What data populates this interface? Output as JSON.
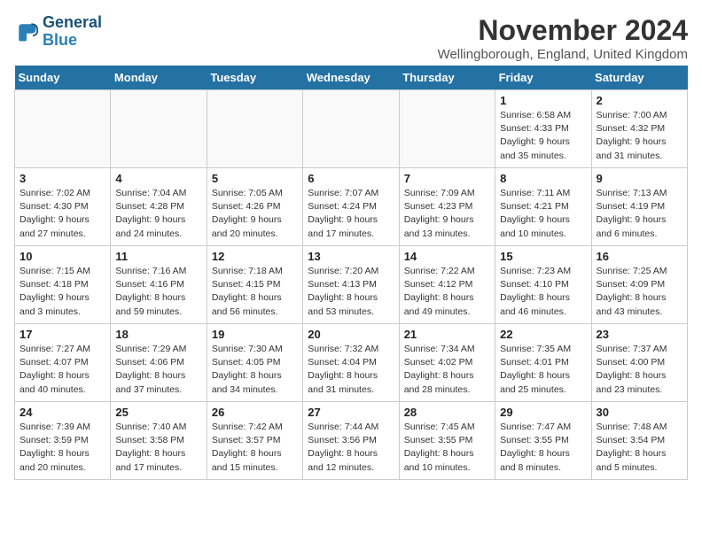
{
  "logo": {
    "line1": "General",
    "line2": "Blue"
  },
  "title": "November 2024",
  "location": "Wellingborough, England, United Kingdom",
  "days_of_week": [
    "Sunday",
    "Monday",
    "Tuesday",
    "Wednesday",
    "Thursday",
    "Friday",
    "Saturday"
  ],
  "weeks": [
    [
      {
        "day": "",
        "info": "",
        "empty": true
      },
      {
        "day": "",
        "info": "",
        "empty": true
      },
      {
        "day": "",
        "info": "",
        "empty": true
      },
      {
        "day": "",
        "info": "",
        "empty": true
      },
      {
        "day": "",
        "info": "",
        "empty": true
      },
      {
        "day": "1",
        "info": "Sunrise: 6:58 AM\nSunset: 4:33 PM\nDaylight: 9 hours and 35 minutes.",
        "empty": false
      },
      {
        "day": "2",
        "info": "Sunrise: 7:00 AM\nSunset: 4:32 PM\nDaylight: 9 hours and 31 minutes.",
        "empty": false
      }
    ],
    [
      {
        "day": "3",
        "info": "Sunrise: 7:02 AM\nSunset: 4:30 PM\nDaylight: 9 hours and 27 minutes.",
        "empty": false
      },
      {
        "day": "4",
        "info": "Sunrise: 7:04 AM\nSunset: 4:28 PM\nDaylight: 9 hours and 24 minutes.",
        "empty": false
      },
      {
        "day": "5",
        "info": "Sunrise: 7:05 AM\nSunset: 4:26 PM\nDaylight: 9 hours and 20 minutes.",
        "empty": false
      },
      {
        "day": "6",
        "info": "Sunrise: 7:07 AM\nSunset: 4:24 PM\nDaylight: 9 hours and 17 minutes.",
        "empty": false
      },
      {
        "day": "7",
        "info": "Sunrise: 7:09 AM\nSunset: 4:23 PM\nDaylight: 9 hours and 13 minutes.",
        "empty": false
      },
      {
        "day": "8",
        "info": "Sunrise: 7:11 AM\nSunset: 4:21 PM\nDaylight: 9 hours and 10 minutes.",
        "empty": false
      },
      {
        "day": "9",
        "info": "Sunrise: 7:13 AM\nSunset: 4:19 PM\nDaylight: 9 hours and 6 minutes.",
        "empty": false
      }
    ],
    [
      {
        "day": "10",
        "info": "Sunrise: 7:15 AM\nSunset: 4:18 PM\nDaylight: 9 hours and 3 minutes.",
        "empty": false
      },
      {
        "day": "11",
        "info": "Sunrise: 7:16 AM\nSunset: 4:16 PM\nDaylight: 8 hours and 59 minutes.",
        "empty": false
      },
      {
        "day": "12",
        "info": "Sunrise: 7:18 AM\nSunset: 4:15 PM\nDaylight: 8 hours and 56 minutes.",
        "empty": false
      },
      {
        "day": "13",
        "info": "Sunrise: 7:20 AM\nSunset: 4:13 PM\nDaylight: 8 hours and 53 minutes.",
        "empty": false
      },
      {
        "day": "14",
        "info": "Sunrise: 7:22 AM\nSunset: 4:12 PM\nDaylight: 8 hours and 49 minutes.",
        "empty": false
      },
      {
        "day": "15",
        "info": "Sunrise: 7:23 AM\nSunset: 4:10 PM\nDaylight: 8 hours and 46 minutes.",
        "empty": false
      },
      {
        "day": "16",
        "info": "Sunrise: 7:25 AM\nSunset: 4:09 PM\nDaylight: 8 hours and 43 minutes.",
        "empty": false
      }
    ],
    [
      {
        "day": "17",
        "info": "Sunrise: 7:27 AM\nSunset: 4:07 PM\nDaylight: 8 hours and 40 minutes.",
        "empty": false
      },
      {
        "day": "18",
        "info": "Sunrise: 7:29 AM\nSunset: 4:06 PM\nDaylight: 8 hours and 37 minutes.",
        "empty": false
      },
      {
        "day": "19",
        "info": "Sunrise: 7:30 AM\nSunset: 4:05 PM\nDaylight: 8 hours and 34 minutes.",
        "empty": false
      },
      {
        "day": "20",
        "info": "Sunrise: 7:32 AM\nSunset: 4:04 PM\nDaylight: 8 hours and 31 minutes.",
        "empty": false
      },
      {
        "day": "21",
        "info": "Sunrise: 7:34 AM\nSunset: 4:02 PM\nDaylight: 8 hours and 28 minutes.",
        "empty": false
      },
      {
        "day": "22",
        "info": "Sunrise: 7:35 AM\nSunset: 4:01 PM\nDaylight: 8 hours and 25 minutes.",
        "empty": false
      },
      {
        "day": "23",
        "info": "Sunrise: 7:37 AM\nSunset: 4:00 PM\nDaylight: 8 hours and 23 minutes.",
        "empty": false
      }
    ],
    [
      {
        "day": "24",
        "info": "Sunrise: 7:39 AM\nSunset: 3:59 PM\nDaylight: 8 hours and 20 minutes.",
        "empty": false
      },
      {
        "day": "25",
        "info": "Sunrise: 7:40 AM\nSunset: 3:58 PM\nDaylight: 8 hours and 17 minutes.",
        "empty": false
      },
      {
        "day": "26",
        "info": "Sunrise: 7:42 AM\nSunset: 3:57 PM\nDaylight: 8 hours and 15 minutes.",
        "empty": false
      },
      {
        "day": "27",
        "info": "Sunrise: 7:44 AM\nSunset: 3:56 PM\nDaylight: 8 hours and 12 minutes.",
        "empty": false
      },
      {
        "day": "28",
        "info": "Sunrise: 7:45 AM\nSunset: 3:55 PM\nDaylight: 8 hours and 10 minutes.",
        "empty": false
      },
      {
        "day": "29",
        "info": "Sunrise: 7:47 AM\nSunset: 3:55 PM\nDaylight: 8 hours and 8 minutes.",
        "empty": false
      },
      {
        "day": "30",
        "info": "Sunrise: 7:48 AM\nSunset: 3:54 PM\nDaylight: 8 hours and 5 minutes.",
        "empty": false
      }
    ]
  ]
}
